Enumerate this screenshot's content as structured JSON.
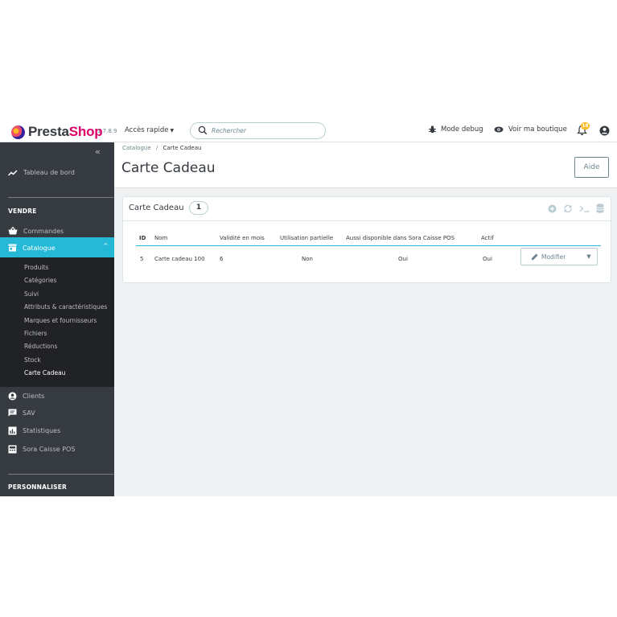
{
  "header": {
    "logo_part1": "Presta",
    "logo_part2": "Shop",
    "version": "1.7.8.9",
    "quick_access": "Accès rapide",
    "search_placeholder": "Rechercher",
    "debug_mode": "Mode debug",
    "view_shop": "Voir ma boutique",
    "notifications_count": "18"
  },
  "sidebar": {
    "dashboard": "Tableau de bord",
    "section_sell": "VENDRE",
    "orders": "Commandes",
    "catalog": "Catalogue",
    "catalog_items": [
      "Produits",
      "Catégories",
      "Suivi",
      "Attributs & caractéristiques",
      "Marques et fournisseurs",
      "Fichiers",
      "Réductions",
      "Stock",
      "Carte Cadeau"
    ],
    "clients": "Clients",
    "sav": "SAV",
    "stats": "Statistiques",
    "pos": "Sora Caisse POS",
    "section_customize": "PERSONNALISER"
  },
  "breadcrumb": {
    "parent": "Catalogue",
    "separator": "/",
    "current": "Carte Cadeau"
  },
  "page": {
    "title": "Carte Cadeau",
    "help": "Aide"
  },
  "panel": {
    "title": "Carte Cadeau",
    "count": "1",
    "columns": [
      "ID",
      "Nom",
      "Validité en mois",
      "Utilisation partielle",
      "Aussi disponible dans Sora Caisse POS",
      "Actif"
    ],
    "rows": [
      {
        "id": "5",
        "name": "Carte cadeau 100",
        "validity": "6",
        "partial": "Non",
        "pos": "Oui",
        "active": "Oui",
        "edit": "Modifier"
      }
    ]
  },
  "colors": {
    "sidebar_bg": "#363a41",
    "accent": "#25b9d7",
    "brand_pink": "#df0067"
  }
}
